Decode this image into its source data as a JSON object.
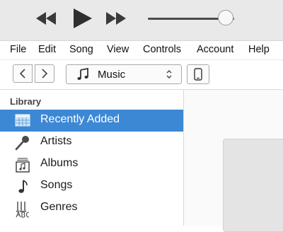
{
  "player": {
    "previous_icon": "rewind-icon",
    "play_icon": "play-icon",
    "next_icon": "fast-forward-icon",
    "volume_level": 0.9
  },
  "menu": [
    "File",
    "Edit",
    "Song",
    "View",
    "Controls",
    "Account",
    "Help"
  ],
  "nav": {
    "back_icon": "chevron-left-icon",
    "forward_icon": "chevron-right-icon",
    "media_select": "Music",
    "media_icon": "music-note-icon",
    "device_icon": "phone-icon"
  },
  "sidebar": {
    "section_title": "Library",
    "items": [
      {
        "label": "Recently Added",
        "icon": "recently-added-icon",
        "selected": true
      },
      {
        "label": "Artists",
        "icon": "microphone-icon",
        "selected": false
      },
      {
        "label": "Albums",
        "icon": "album-icon",
        "selected": false
      },
      {
        "label": "Songs",
        "icon": "music-note-icon",
        "selected": false
      },
      {
        "label": "Genres",
        "icon": "genres-icon",
        "selected": false
      }
    ]
  },
  "colors": {
    "selection": "#3d88d4",
    "transport_bg": "#e9e9e9"
  }
}
